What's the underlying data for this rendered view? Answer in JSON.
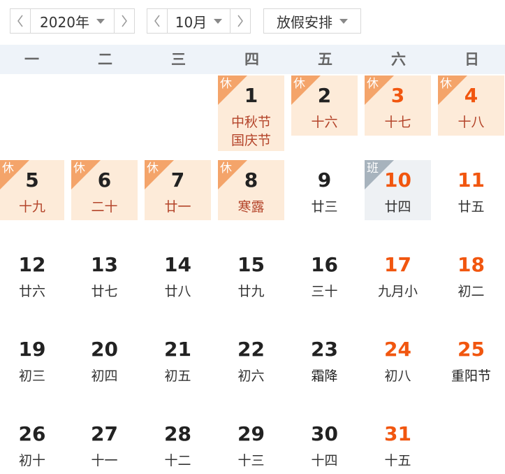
{
  "toolbar": {
    "year_label": "2020年",
    "month_label": "10月",
    "holiday_label": "放假安排"
  },
  "weekdays": [
    "一",
    "二",
    "三",
    "四",
    "五",
    "六",
    "日"
  ],
  "colors": {
    "holiday_bg": "#fdebd9",
    "workday_bg": "#eef1f4",
    "weekend_red": "#f1560f",
    "badge_orange": "#f4a46a"
  },
  "days": {
    "d1": {
      "num": "1",
      "lunar": "中秋节",
      "lunar2": "国庆节",
      "badge": "休"
    },
    "d2": {
      "num": "2",
      "lunar": "十六",
      "badge": "休"
    },
    "d3": {
      "num": "3",
      "lunar": "十七",
      "badge": "休"
    },
    "d4": {
      "num": "4",
      "lunar": "十八",
      "badge": "休"
    },
    "d5": {
      "num": "5",
      "lunar": "十九",
      "badge": "休"
    },
    "d6": {
      "num": "6",
      "lunar": "二十",
      "badge": "休"
    },
    "d7": {
      "num": "7",
      "lunar": "廿一",
      "badge": "休"
    },
    "d8": {
      "num": "8",
      "lunar": "寒露",
      "badge": "休"
    },
    "d9": {
      "num": "9",
      "lunar": "廿三"
    },
    "d10": {
      "num": "10",
      "lunar": "廿四",
      "badge": "班"
    },
    "d11": {
      "num": "11",
      "lunar": "廿五"
    },
    "d12": {
      "num": "12",
      "lunar": "廿六"
    },
    "d13": {
      "num": "13",
      "lunar": "廿七"
    },
    "d14": {
      "num": "14",
      "lunar": "廿八"
    },
    "d15": {
      "num": "15",
      "lunar": "廿九"
    },
    "d16": {
      "num": "16",
      "lunar": "三十"
    },
    "d17": {
      "num": "17",
      "lunar": "九月小"
    },
    "d18": {
      "num": "18",
      "lunar": "初二"
    },
    "d19": {
      "num": "19",
      "lunar": "初三"
    },
    "d20": {
      "num": "20",
      "lunar": "初四"
    },
    "d21": {
      "num": "21",
      "lunar": "初五"
    },
    "d22": {
      "num": "22",
      "lunar": "初六"
    },
    "d23": {
      "num": "23",
      "lunar": "霜降"
    },
    "d24": {
      "num": "24",
      "lunar": "初八"
    },
    "d25": {
      "num": "25",
      "lunar": "重阳节"
    },
    "d26": {
      "num": "26",
      "lunar": "初十"
    },
    "d27": {
      "num": "27",
      "lunar": "十一"
    },
    "d28": {
      "num": "28",
      "lunar": "十二"
    },
    "d29": {
      "num": "29",
      "lunar": "十三"
    },
    "d30": {
      "num": "30",
      "lunar": "十四"
    },
    "d31": {
      "num": "31",
      "lunar": "十五"
    }
  }
}
